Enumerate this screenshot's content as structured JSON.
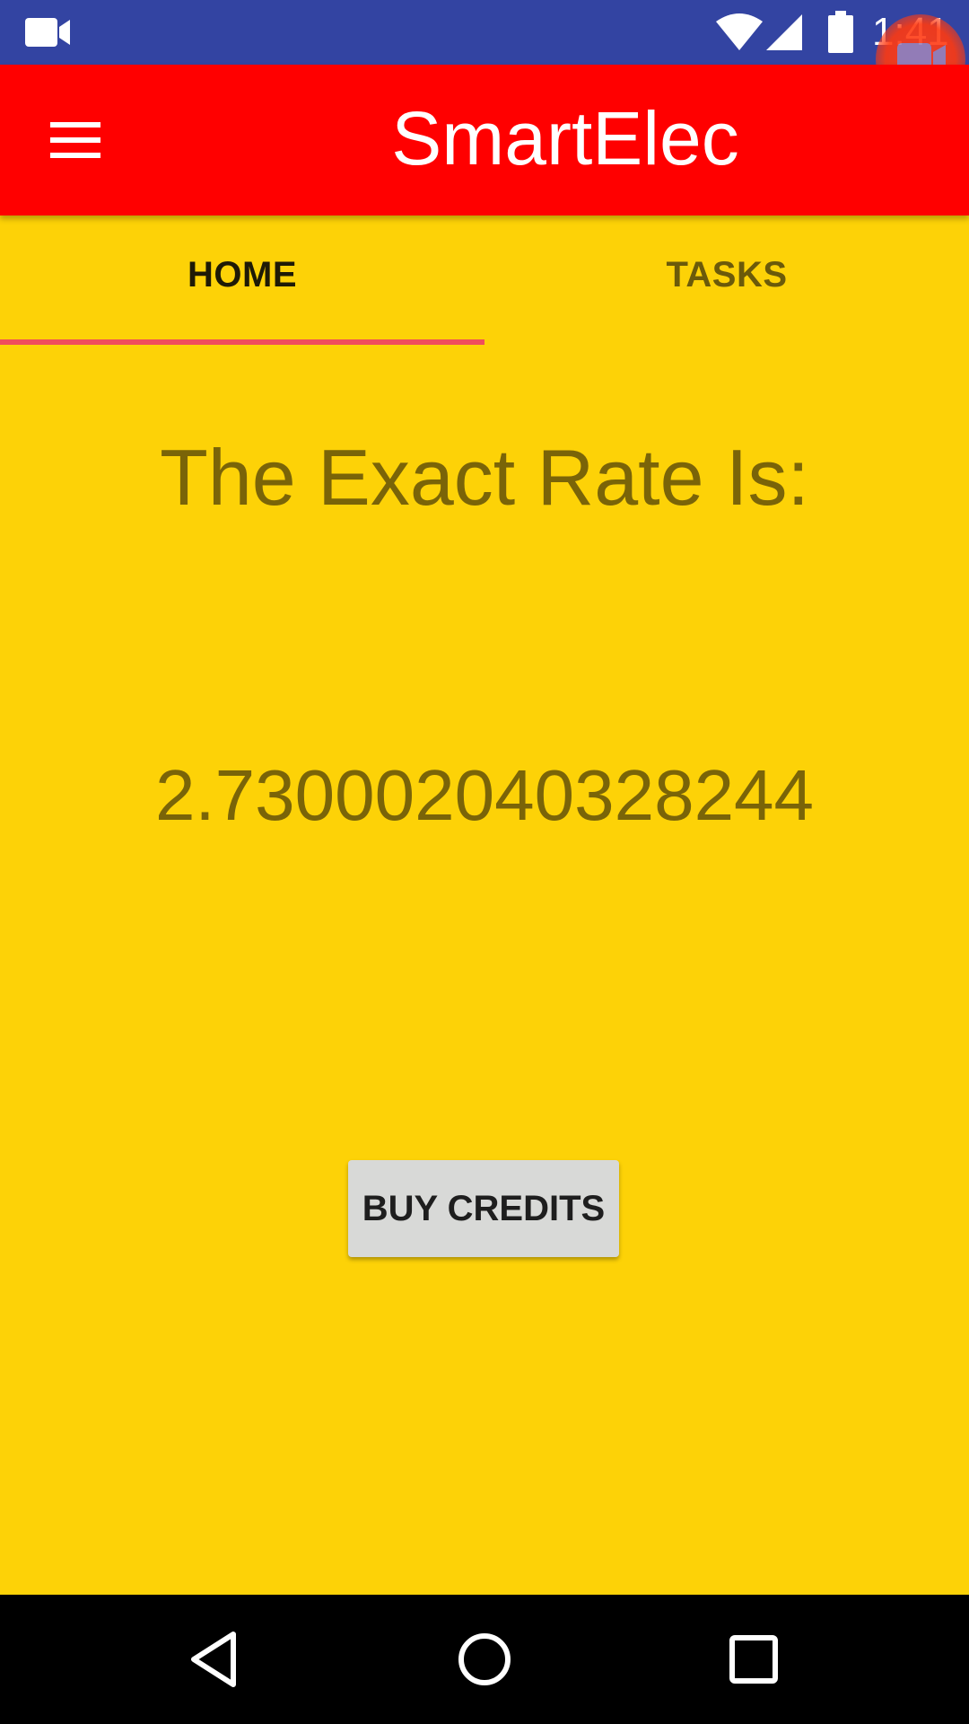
{
  "status_bar": {
    "time": "1:41",
    "background_color": "#3344A2",
    "icons": [
      "video-camera-icon",
      "wifi-icon",
      "cell-signal-icon",
      "battery-icon"
    ]
  },
  "screen_record_bubble": {
    "icon": "video-camera-icon",
    "color": "#FF3A10"
  },
  "app_bar": {
    "title": "SmartElec",
    "menu_icon": "hamburger-menu-icon",
    "background_color": "#FF0000"
  },
  "tabs": [
    {
      "label": "HOME",
      "selected": true
    },
    {
      "label": "TASKS",
      "selected": false
    }
  ],
  "tab_indicator_color": "#F04E5C",
  "main": {
    "heading": "The Exact Rate Is:",
    "rate_value": "2.730002040328244",
    "buy_button_label": "BUY CREDITS",
    "background_color": "#FDD207",
    "text_color": "#7A6408"
  },
  "nav_bar": {
    "buttons": [
      "back-icon",
      "home-icon",
      "recent-apps-icon"
    ]
  }
}
